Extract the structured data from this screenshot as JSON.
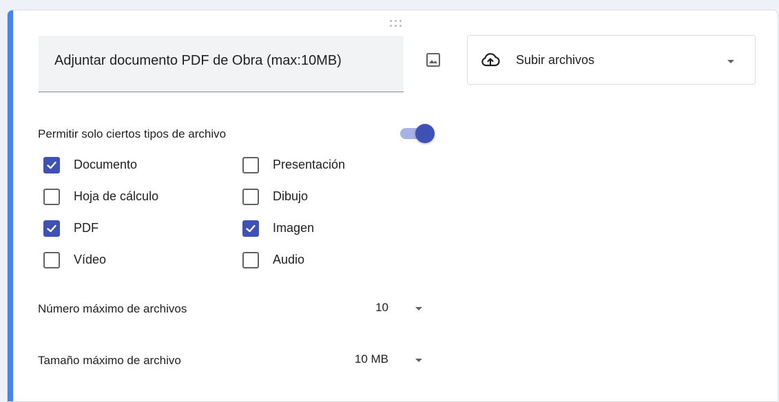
{
  "question": {
    "title": "Adjuntar documento PDF de Obra (max:10MB)",
    "type_label": "Subir archivos",
    "image_icon": "image-icon",
    "type_icon": "cloud-upload-icon"
  },
  "file_types": {
    "allow_label": "Permitir solo ciertos tipos de archivo",
    "allow_enabled": true,
    "options": [
      {
        "label": "Documento",
        "checked": true
      },
      {
        "label": "Presentación",
        "checked": false
      },
      {
        "label": "Hoja de cálculo",
        "checked": false
      },
      {
        "label": "Dibujo",
        "checked": false
      },
      {
        "label": "PDF",
        "checked": true
      },
      {
        "label": "Imagen",
        "checked": true
      },
      {
        "label": "Vídeo",
        "checked": false
      },
      {
        "label": "Audio",
        "checked": false
      }
    ]
  },
  "limits": {
    "max_files_label": "Número máximo de archivos",
    "max_files_value": "10",
    "max_size_label": "Tamaño máximo de archivo",
    "max_size_value": "10 MB"
  },
  "colors": {
    "accent_bar": "#4285f4",
    "checkbox_checked": "#3f51b5",
    "toggle_thumb": "#3f51b5",
    "toggle_track": "#a8b1e6"
  }
}
